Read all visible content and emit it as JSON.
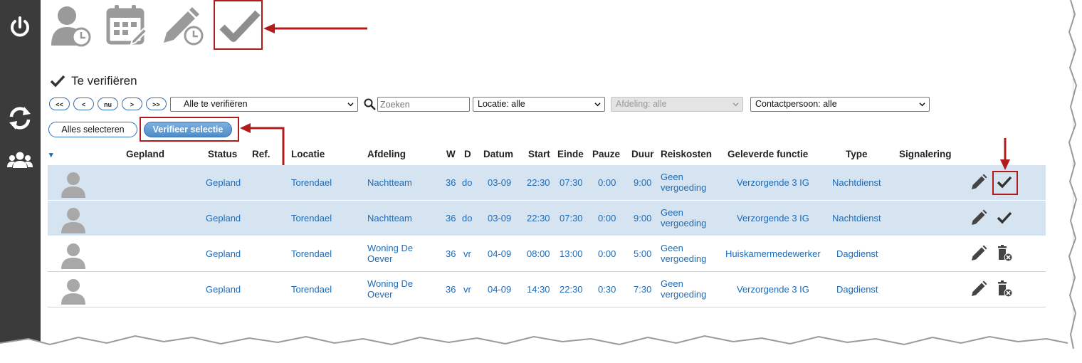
{
  "toolbar": {
    "icons": [
      "person-clock-icon",
      "calendar-grid-icon",
      "pencil-clock-icon",
      "checkmark-icon"
    ]
  },
  "sidebar": {
    "icons": [
      "power-icon",
      "refresh-icon",
      "users-icon"
    ]
  },
  "section": {
    "title": "Te verifiëren"
  },
  "filters": {
    "nav": [
      "<<",
      "<",
      "nu",
      ">",
      ">>"
    ],
    "verify_select": "Alle te verifiëren",
    "search_placeholder": "Zoeken",
    "location": "Locatie: alle",
    "department": "Afdeling: alle",
    "contact": "Contactpersoon: alle"
  },
  "actions": {
    "select_all": "Alles selecteren",
    "verify_selection": "Verifieer selectie"
  },
  "table": {
    "sort_indicator": "▾",
    "headers": {
      "gepland": "Gepland",
      "status": "Status",
      "ref": "Ref.",
      "locatie": "Locatie",
      "afdeling": "Afdeling",
      "w": "W",
      "d": "D",
      "datum": "Datum",
      "start": "Start",
      "einde": "Einde",
      "pauze": "Pauze",
      "duur": "Duur",
      "reiskosten": "Reiskosten",
      "functie": "Geleverde functie",
      "type": "Type",
      "signalering": "Signalering"
    },
    "rows": [
      {
        "status": "Gepland",
        "locatie": "Torendael",
        "afdeling": "Nachtteam",
        "w": "36",
        "d": "do",
        "datum": "03-09",
        "start": "22:30",
        "einde": "07:30",
        "pauze": "0:00",
        "duur": "9:00",
        "reiskosten": "Geen vergoeding",
        "functie": "Verzorgende 3 IG",
        "type": "Nachtdienst",
        "action": "checkmark-icon",
        "selected": true
      },
      {
        "status": "Gepland",
        "locatie": "Torendael",
        "afdeling": "Nachtteam",
        "w": "36",
        "d": "do",
        "datum": "03-09",
        "start": "22:30",
        "einde": "07:30",
        "pauze": "0:00",
        "duur": "9:00",
        "reiskosten": "Geen vergoeding",
        "functie": "Verzorgende 3 IG",
        "type": "Nachtdienst",
        "action": "checkmark-icon",
        "selected": true
      },
      {
        "status": "Gepland",
        "locatie": "Torendael",
        "afdeling": "Woning De Oever",
        "w": "36",
        "d": "vr",
        "datum": "04-09",
        "start": "08:00",
        "einde": "13:00",
        "pauze": "0:00",
        "duur": "5:00",
        "reiskosten": "Geen vergoeding",
        "functie": "Huiskamermedewerker",
        "type": "Dagdienst",
        "action": "delete-icon",
        "selected": false
      },
      {
        "status": "Gepland",
        "locatie": "Torendael",
        "afdeling": "Woning De Oever",
        "w": "36",
        "d": "vr",
        "datum": "04-09",
        "start": "14:30",
        "einde": "22:30",
        "pauze": "0:30",
        "duur": "7:30",
        "reiskosten": "Geen vergoeding",
        "functie": "Verzorgende 3 IG",
        "type": "Dagdienst",
        "action": "delete-icon",
        "selected": false
      }
    ]
  },
  "colors": {
    "sidebar": "#3b3b3b",
    "link": "#1f6bb5",
    "selected_row": "#d5e4f0",
    "callout": "#b01c1c",
    "button_blue": "#4d8cc8"
  }
}
